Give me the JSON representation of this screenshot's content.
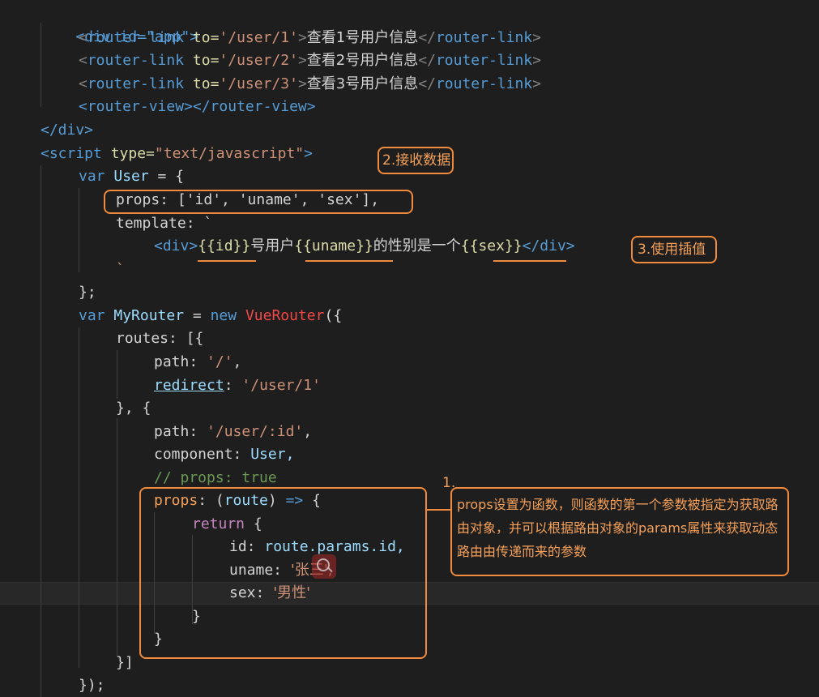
{
  "code": {
    "div_open": "<div id=\"app\">",
    "links": [
      {
        "to": "'/user/1'",
        "text": "查看1号用户信息"
      },
      {
        "to": "'/user/2'",
        "text": "查看2号用户信息"
      },
      {
        "to": "'/user/3'",
        "text": "查看3号用户信息"
      }
    ],
    "router_view": "<router-view></router-view>",
    "div_close": "</div>",
    "script_open_tag": "<script",
    "script_type": "type=",
    "script_type_val": "\"text/javascript\"",
    "var_user": "var",
    "user_ident": "User",
    "props_line": "props: ['id', 'uname', 'sex'],",
    "template_kw": "template: `",
    "template_div_open": "<div>",
    "tpl_id": "{{id}}",
    "tpl_text1": "号用户",
    "tpl_uname": "{{uname}}",
    "tpl_text2": "的性别是一个",
    "tpl_sex": "{{sex}}",
    "template_div_close": "</div>",
    "backtick": "`",
    "close_brace_semi": "};",
    "my_router": "MyRouter",
    "new_kw": "new",
    "vue_router": "VueRouter",
    "routes": "routes: [{",
    "path1": "'/'",
    "redirect": "redirect",
    "redirect_val": "'/user/1'",
    "close_open": "}, {",
    "path2": "'/user/:id'",
    "component": "component:",
    "component_val": "User,",
    "comment": "// props: true",
    "props_fn": "props",
    "route_param": "route",
    "return_kw": "return",
    "id_key": "id:",
    "id_val": "route.params.id,",
    "uname_key": "uname:",
    "uname_val": "'张三',",
    "sex_key": "sex:",
    "sex_val": "'男性'",
    "brace_close": "}",
    "bracket_close": "}]",
    "final_close": "});"
  },
  "annotations": {
    "note1_num": "1.",
    "note1_text": "props设置为函数，则函数的第一个参数被指定为获取路由对象，并可以根据路由对象的params属性来获取动态路由由传递而来的参数",
    "note2": "2.接收数据",
    "note3": "3.使用插值"
  }
}
